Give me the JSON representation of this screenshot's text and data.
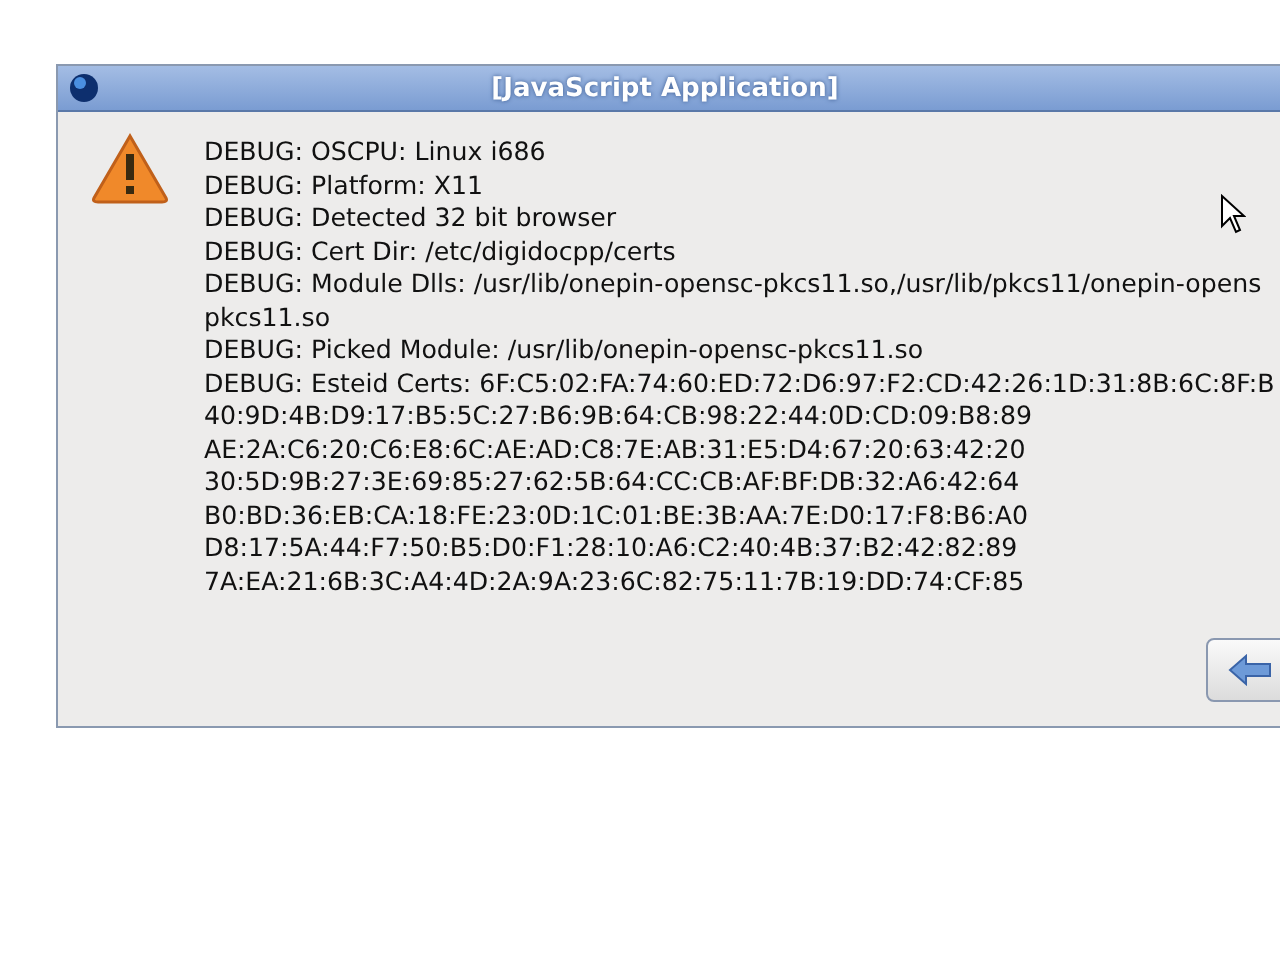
{
  "window": {
    "title": "[JavaScript Application]"
  },
  "message_lines": [
    "DEBUG: OSCPU: Linux i686",
    "DEBUG: Platform: X11",
    "DEBUG: Detected 32 bit browser",
    "DEBUG: Cert Dir: /etc/digidocpp/certs",
    "DEBUG: Module Dlls: /usr/lib/onepin-opensc-pkcs11.so,/usr/lib/pkcs11/onepin-opens",
    "pkcs11.so",
    "DEBUG: Picked Module: /usr/lib/onepin-opensc-pkcs11.so",
    "DEBUG: Esteid Certs: 6F:C5:02:FA:74:60:ED:72:D6:97:F2:CD:42:26:1D:31:8B:6C:8F:B",
    "40:9D:4B:D9:17:B5:5C:27:B6:9B:64:CB:98:22:44:0D:CD:09:B8:89",
    "AE:2A:C6:20:C6:E8:6C:AE:AD:C8:7E:AB:31:E5:D4:67:20:63:42:20",
    "30:5D:9B:27:3E:69:85:27:62:5B:64:CC:CB:AF:BF:DB:32:A6:42:64",
    "B0:BD:36:EB:CA:18:FE:23:0D:1C:01:BE:3B:AA:7E:D0:17:F8:B6:A0",
    "D8:17:5A:44:F7:50:B5:D0:F1:28:10:A6:C2:40:4B:37:B2:42:82:89",
    "7A:EA:21:6B:3C:A4:4D:2A:9A:23:6C:82:75:11:7B:19:DD:74:CF:85"
  ]
}
